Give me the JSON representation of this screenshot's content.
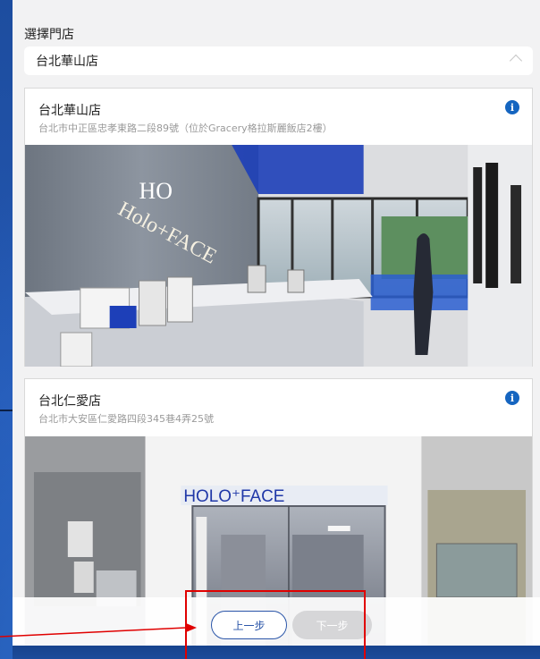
{
  "selector": {
    "label": "選擇門店",
    "selected": "台北華山店"
  },
  "stores": [
    {
      "name": "台北華山店",
      "address": "台北市中正區忠孝東路二段89號（位於Gracery格拉斯麗飯店2樓）",
      "info_icon": "info-icon",
      "photo_text": [
        "HO",
        "Holo+FACE"
      ]
    },
    {
      "name": "台北仁愛店",
      "address": "台北市大安區仁愛路四段345巷4弄25號",
      "info_icon": "info-icon",
      "photo_text": [
        "HOLO⁺FACE"
      ]
    }
  ],
  "buttons": {
    "prev": "上一步",
    "next": "下一步"
  },
  "colors": {
    "accent": "#2a55a8",
    "info": "#1565c0",
    "highlight": "#e00000",
    "background": "#1f4fa0"
  }
}
